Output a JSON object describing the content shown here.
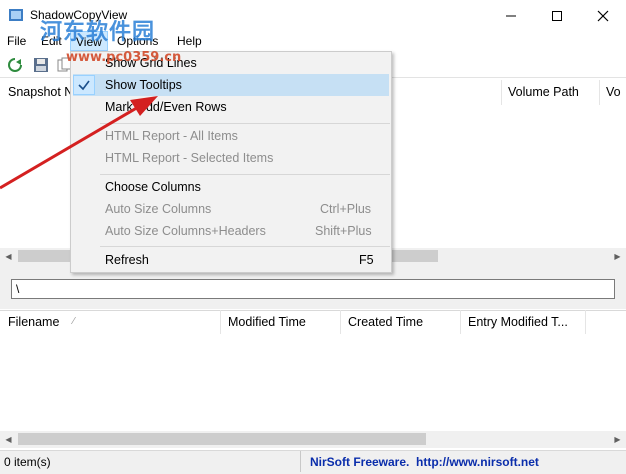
{
  "window": {
    "title": "ShadowCopyView",
    "controls": {
      "minimize": "minimize-icon",
      "maximize": "maximize-icon",
      "close": "close-icon"
    }
  },
  "menubar": {
    "items": [
      {
        "label": "File"
      },
      {
        "label": "Edit"
      },
      {
        "label": "View"
      },
      {
        "label": "Options"
      },
      {
        "label": "Help"
      }
    ]
  },
  "upper_list": {
    "columns": [
      {
        "label": "Snapshot N"
      },
      {
        "label": "Volume Path"
      },
      {
        "label": "Vo"
      }
    ]
  },
  "path_field": {
    "value": "\\"
  },
  "lower_list": {
    "columns": [
      {
        "label": "Filename"
      },
      {
        "label": "Modified Time"
      },
      {
        "label": "Created Time"
      },
      {
        "label": "Entry Modified T..."
      }
    ]
  },
  "view_menu": {
    "items": [
      {
        "label": "Show Grid Lines",
        "shortcut": "",
        "enabled": true,
        "checked": false
      },
      {
        "label": "Show Tooltips",
        "shortcut": "",
        "enabled": true,
        "checked": true
      },
      {
        "label": "Mark Odd/Even Rows",
        "shortcut": "",
        "enabled": true,
        "checked": false
      },
      {
        "label": "HTML Report - All Items",
        "shortcut": "",
        "enabled": false,
        "checked": false
      },
      {
        "label": "HTML Report - Selected Items",
        "shortcut": "",
        "enabled": false,
        "checked": false
      },
      {
        "label": "Choose Columns",
        "shortcut": "",
        "enabled": true,
        "checked": false
      },
      {
        "label": "Auto Size Columns",
        "shortcut": "Ctrl+Plus",
        "enabled": false,
        "checked": false
      },
      {
        "label": "Auto Size Columns+Headers",
        "shortcut": "Shift+Plus",
        "enabled": false,
        "checked": false
      },
      {
        "label": "Refresh",
        "shortcut": "F5",
        "enabled": true,
        "checked": false
      }
    ]
  },
  "statusbar": {
    "count": "0 item(s)",
    "link": "NirSoft Freeware.  http://www.nirsoft.net"
  },
  "watermark": {
    "line1": "河东软件园",
    "line2": "www.pc0359.cn"
  },
  "colors": {
    "menu_highlight": "#cce8ff",
    "link": "#0a2dab",
    "arrow": "#d42020"
  }
}
